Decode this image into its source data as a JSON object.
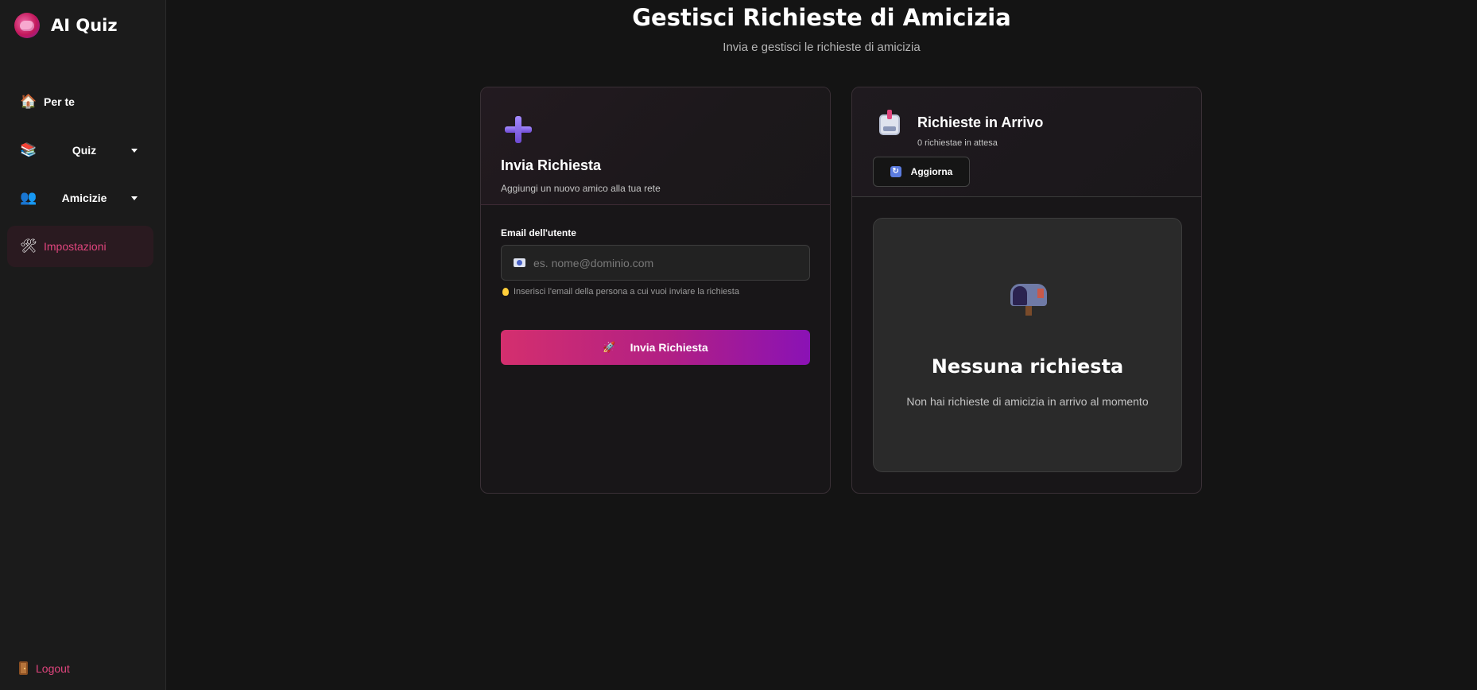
{
  "app": {
    "title": "AI Quiz",
    "logo_icon": "brain-icon"
  },
  "sidebar": {
    "items": [
      {
        "label": "Per te",
        "icon": "house-icon",
        "dropdown": false,
        "active": false
      },
      {
        "label": "Quiz",
        "icon": "books-icon",
        "dropdown": true,
        "active": false
      },
      {
        "label": "Amicizie",
        "icon": "people-icon",
        "dropdown": true,
        "active": false
      },
      {
        "label": "Impostazioni",
        "icon": "tools-icon",
        "dropdown": false,
        "active": true
      }
    ],
    "logout_label": "Logout",
    "logout_icon": "door-icon"
  },
  "header": {
    "title": "Gestisci Richieste di Amicizia",
    "subtitle": "Invia e gestisci le richieste di amicizia"
  },
  "send_card": {
    "icon": "plus-icon",
    "title": "Invia Richiesta",
    "description": "Aggiungi un nuovo amico alla tua rete",
    "email_label": "Email dell'utente",
    "email_value": "",
    "email_placeholder": "es. nome@dominio.com",
    "hint": "Inserisci l'email della persona a cui vuoi inviare la richiesta",
    "submit_label": "Invia Richiesta"
  },
  "incoming_card": {
    "icon": "inbox-tray-icon",
    "title": "Richieste in Arrivo",
    "count_text": "0 richiestae in attesa",
    "refresh_label": "Aggiorna",
    "empty_icon": "mailbox-icon",
    "empty_title": "Nessuna richiesta",
    "empty_description": "Non hai richieste di amicizia in arrivo al momento"
  },
  "colors": {
    "accent": "#e0457d",
    "button_gradient_start": "#d42f6e",
    "button_gradient_end": "#8a12b5",
    "background": "#141414",
    "sidebar": "#1b1b1b"
  }
}
